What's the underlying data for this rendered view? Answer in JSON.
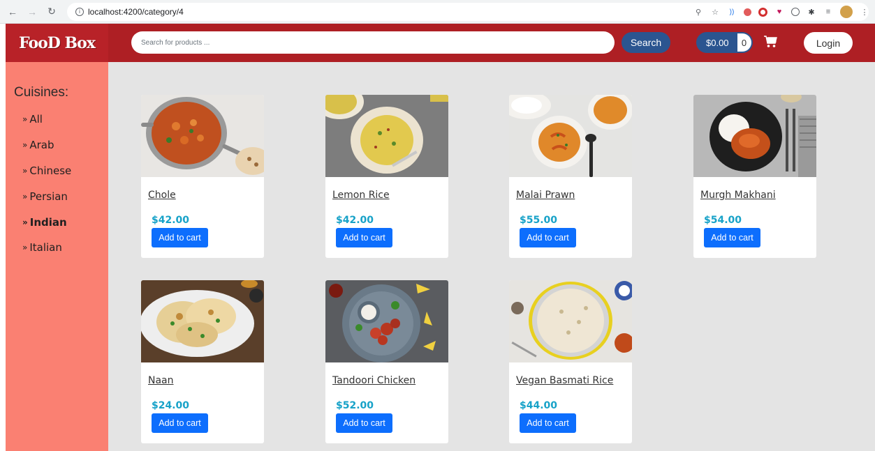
{
  "browser": {
    "url": "localhost:4200/category/4"
  },
  "header": {
    "logo": "FooD Box",
    "search_placeholder": "Search for products ...",
    "search_label": "Search",
    "cart_amount": "$0.00",
    "cart_count": "0",
    "login_label": "Login"
  },
  "sidebar": {
    "title": "Cuisines:",
    "items": [
      {
        "label": "All",
        "active": false
      },
      {
        "label": "Arab",
        "active": false
      },
      {
        "label": "Chinese",
        "active": false
      },
      {
        "label": "Persian",
        "active": false
      },
      {
        "label": "Indian",
        "active": true
      },
      {
        "label": "Italian",
        "active": false
      }
    ]
  },
  "products": [
    {
      "name": "Chole",
      "price": "$42.00",
      "button": "Add to cart"
    },
    {
      "name": "Lemon Rice",
      "price": "$42.00",
      "button": "Add to cart"
    },
    {
      "name": "Malai Prawn",
      "price": "$55.00",
      "button": "Add to cart"
    },
    {
      "name": "Murgh Makhani",
      "price": "$54.00",
      "button": "Add to cart"
    },
    {
      "name": "Naan",
      "price": "$24.00",
      "button": "Add to cart"
    },
    {
      "name": "Tandoori Chicken",
      "price": "$52.00",
      "button": "Add to cart"
    },
    {
      "name": "Vegan Basmati Rice",
      "price": "$44.00",
      "button": "Add to cart"
    }
  ],
  "colors": {
    "header": "#ae1f24",
    "sidebar": "#fa8072",
    "accent": "#2b5590",
    "price": "#17a2c8",
    "button": "#0d6efd"
  }
}
